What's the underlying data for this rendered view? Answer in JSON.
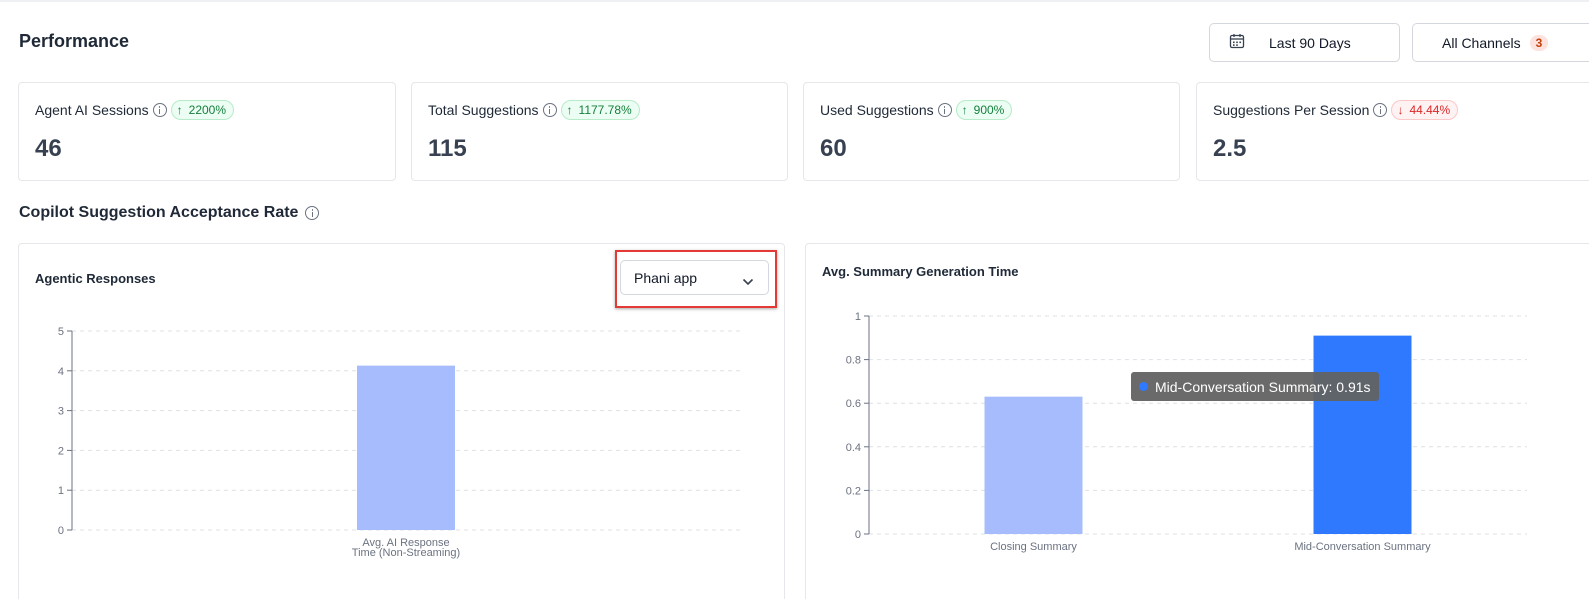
{
  "page": {
    "title": "Performance"
  },
  "filters": {
    "date_range": "Last 90 Days",
    "channels": "All Channels",
    "channel_count": "3"
  },
  "kpis": [
    {
      "label": "Agent AI Sessions",
      "value": "46",
      "trend": "2200%",
      "direction": "up"
    },
    {
      "label": "Total Suggestions",
      "value": "115",
      "trend": "1177.78%",
      "direction": "up"
    },
    {
      "label": "Used Suggestions",
      "value": "60",
      "trend": "900%",
      "direction": "up"
    },
    {
      "label": "Suggestions Per Session",
      "value": "2.5",
      "trend": "44.44%",
      "direction": "down"
    }
  ],
  "section": {
    "title": "Copilot Suggestion Acceptance Rate"
  },
  "colors": {
    "bar_light": "#a6bcfd",
    "bar_dark": "#2f79ff",
    "highlight": "#e53935",
    "up": "#15803d",
    "down": "#dc2626"
  },
  "icons": {
    "date": "calendar-icon",
    "info": "info-icon",
    "dropdown": "chevron-down-icon",
    "up": "arrow-up-icon",
    "down": "arrow-down-icon"
  },
  "agentic": {
    "title": "Agentic Responses",
    "app_select": "Phani app"
  },
  "summary": {
    "title": "Avg. Summary Generation Time",
    "tooltip": "Mid-Conversation Summary: 0.91s"
  },
  "chart_data": [
    {
      "type": "bar",
      "categories": [
        "Avg. AI Response Time (Non-Streaming)"
      ],
      "category_lines": [
        [
          "Avg. AI Response",
          "Time (Non-Streaming)"
        ]
      ],
      "values": [
        4.13
      ],
      "ylim": [
        0,
        5
      ],
      "yticks": [
        0,
        1,
        2,
        3,
        4,
        5
      ],
      "grid": true
    },
    {
      "type": "bar",
      "categories": [
        "Closing Summary",
        "Mid-Conversation Summary"
      ],
      "category_lines": [
        [
          "Closing Summary"
        ],
        [
          "Mid-Conversation Summary"
        ]
      ],
      "values": [
        0.63,
        0.91
      ],
      "ylim": [
        0,
        1
      ],
      "yticks": [
        0,
        0.2,
        0.4,
        0.6,
        0.8,
        1
      ],
      "highlighted_index": 1,
      "grid": true
    }
  ]
}
